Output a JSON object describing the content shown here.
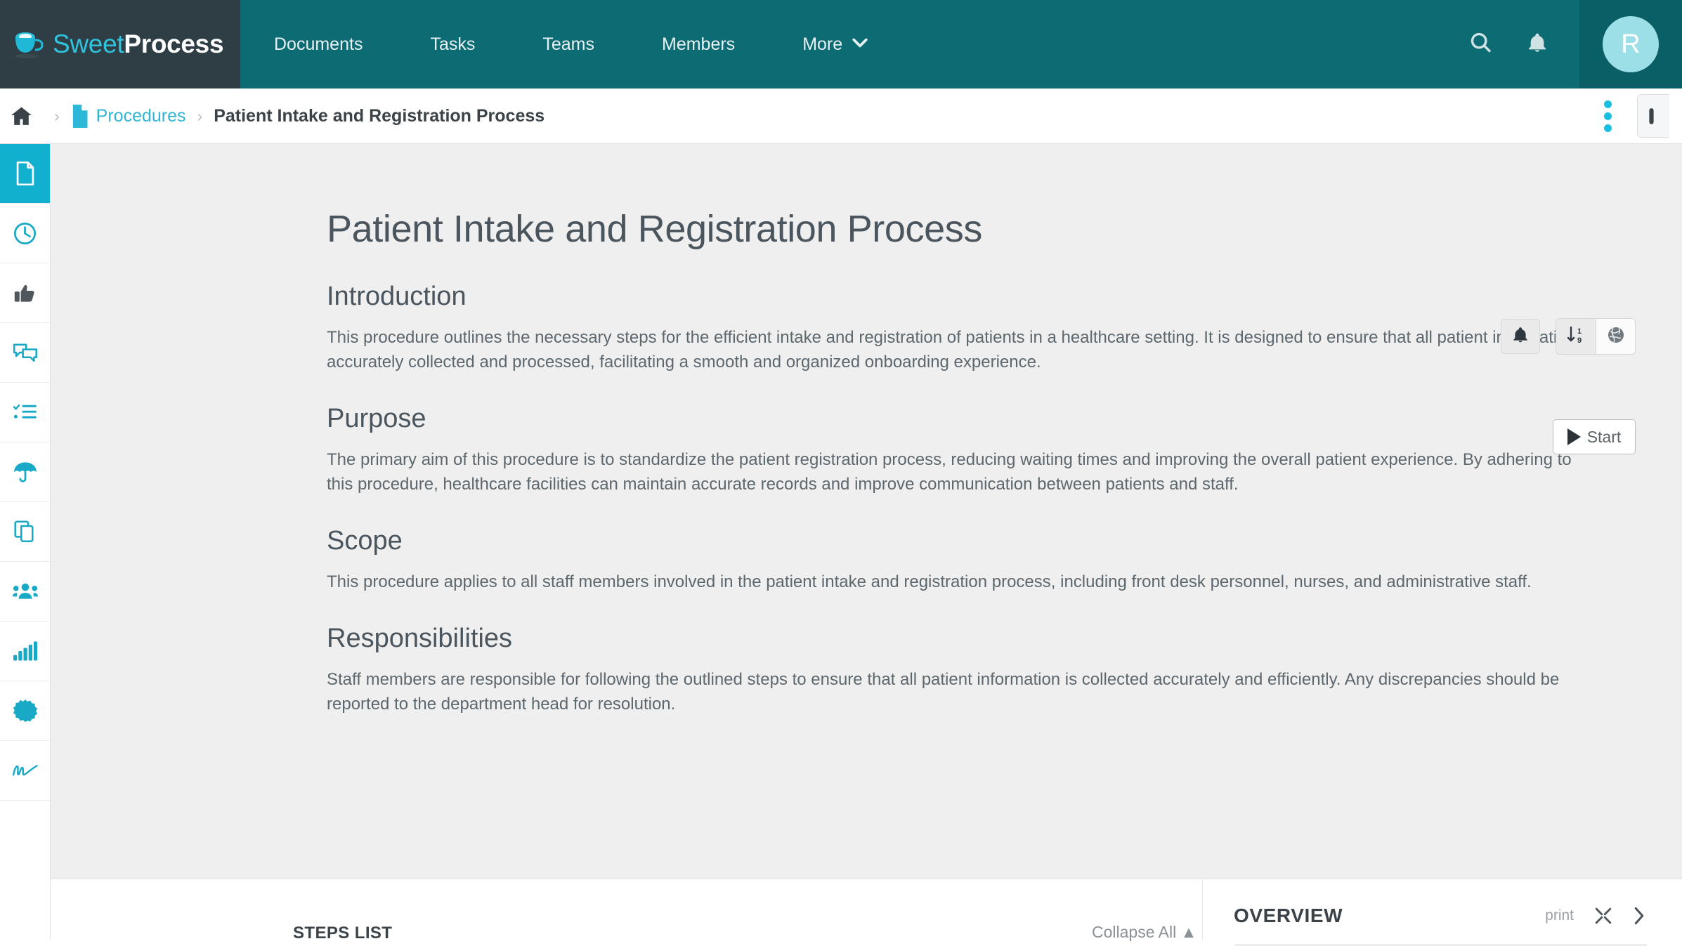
{
  "brand": {
    "logo_light": "Sweet",
    "logo_bold": "Process",
    "logo_icon": "coffee-cup-icon",
    "accent_teal": "#12b0cf",
    "nav_teal": "#0d6b73",
    "logo_bg": "#2f3d44"
  },
  "topnav": {
    "items": [
      {
        "label": "Documents",
        "icon": ""
      },
      {
        "label": "Tasks",
        "icon": ""
      },
      {
        "label": "Teams",
        "icon": ""
      },
      {
        "label": "Members",
        "icon": ""
      },
      {
        "label": "More",
        "icon": "chevron-down-icon",
        "caret": "⌄"
      }
    ],
    "search_icon": "search-icon",
    "bell_icon": "bell-icon",
    "avatar_initial": "R"
  },
  "breadcrumb": {
    "home_icon": "home-icon",
    "doc_icon": "document-icon",
    "separator": "›",
    "parent": "Procedures",
    "current": "Patient Intake and Registration Process",
    "kebab_icon": "more-vertical-icon"
  },
  "sidebar": {
    "items": [
      {
        "name": "document",
        "icon": "document-icon",
        "active": true
      },
      {
        "name": "history",
        "icon": "clock-icon",
        "active": false
      },
      {
        "name": "approvals",
        "icon": "thumbs-up-icon",
        "active": false
      },
      {
        "name": "comments",
        "icon": "chat-bubbles-icon",
        "active": false
      },
      {
        "name": "tasks",
        "icon": "checklist-icon",
        "active": false
      },
      {
        "name": "policies",
        "icon": "umbrella-icon",
        "active": false
      },
      {
        "name": "duplicate",
        "icon": "copy-icon",
        "active": false
      },
      {
        "name": "teams",
        "icon": "users-icon",
        "active": false
      },
      {
        "name": "reports",
        "icon": "bar-chart-icon",
        "active": false
      },
      {
        "name": "settings",
        "icon": "badge-gear-icon",
        "active": false
      },
      {
        "name": "signature",
        "icon": "signature-icon",
        "active": false
      }
    ]
  },
  "document": {
    "title": "Patient Intake and Registration Process",
    "actions": {
      "notify_icon": "bell-icon",
      "sort_icon": "sort-numeric-icon",
      "globe_icon": "globe-icon",
      "start_label": "Start",
      "start_icon": "play-icon"
    },
    "sections": [
      {
        "heading": "Introduction",
        "body": "This procedure outlines the necessary steps for the efficient intake and registration of patients in a healthcare setting. It is designed to ensure that all patient information is accurately collected and processed, facilitating a smooth and organized onboarding experience."
      },
      {
        "heading": "Purpose",
        "body": "The primary aim of this procedure is to standardize the patient registration process, reducing waiting times and improving the overall patient experience. By adhering to this procedure, healthcare facilities can maintain accurate records and improve communication between patients and staff."
      },
      {
        "heading": "Scope",
        "body": "This procedure applies to all staff members involved in the patient intake and registration process, including front desk personnel, nurses, and administrative staff."
      },
      {
        "heading": "Responsibilities",
        "body": "Staff members are responsible for following the outlined steps to ensure that all patient information is collected accurately and efficiently. Any discrepancies should be reported to the department head for resolution."
      }
    ]
  },
  "bottom": {
    "steps_label": "STEPS LIST",
    "collapse_label": "Collapse All ▲",
    "overview_title": "OVERVIEW",
    "print_label": "print",
    "expand_icon": "expand-icon",
    "next_icon": "chevron-right-icon"
  }
}
